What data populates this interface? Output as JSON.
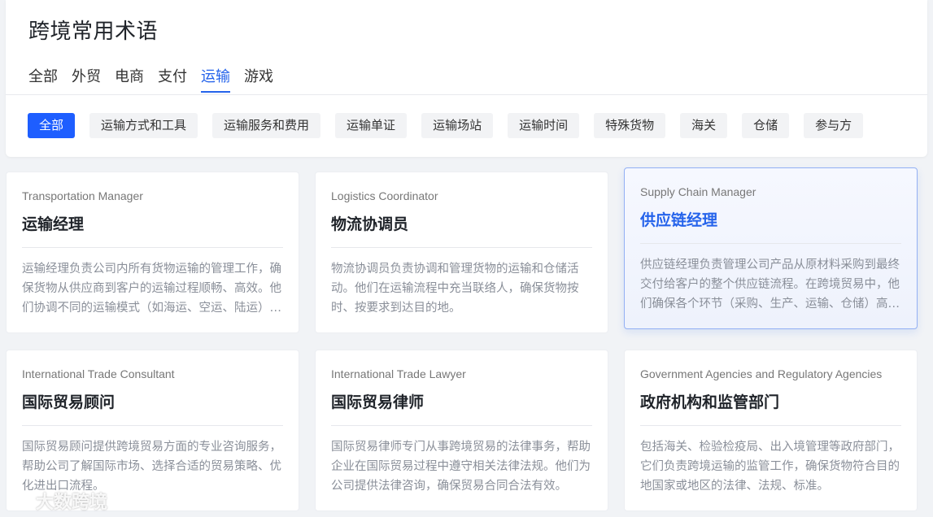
{
  "page": {
    "title": "跨境常用术语"
  },
  "tabs": [
    {
      "label": "全部"
    },
    {
      "label": "外贸"
    },
    {
      "label": "电商"
    },
    {
      "label": "支付"
    },
    {
      "label": "运输"
    },
    {
      "label": "游戏"
    }
  ],
  "active_tab": "运输",
  "filters": [
    {
      "label": "全部"
    },
    {
      "label": "运输方式和工具"
    },
    {
      "label": "运输服务和费用"
    },
    {
      "label": "运输单证"
    },
    {
      "label": "运输场站"
    },
    {
      "label": "运输时间"
    },
    {
      "label": "特殊货物"
    },
    {
      "label": "海关"
    },
    {
      "label": "仓储"
    },
    {
      "label": "参与方"
    }
  ],
  "cards": [
    {
      "en": "Transportation Manager",
      "zh": "运输经理",
      "desc": "运输经理负责公司内所有货物运输的管理工作，确保货物从供应商到客户的运输过程顺畅、高效。他们协调不同的运输模式（如海运、空运、陆运）以优化成本与时效。"
    },
    {
      "en": "Logistics Coordinator",
      "zh": "物流协调员",
      "desc": "物流协调员负责协调和管理货物的运输和仓储活动。他们在运输流程中充当联络人，确保货物按时、按要求到达目的地。"
    },
    {
      "en": "Supply Chain Manager",
      "zh": "供应链经理",
      "desc": "供应链经理负责管理公司产品从原材料采购到最终交付给客户的整个供应链流程。在跨境贸易中，他们确保各个环节（采购、生产、运输、仓储）高效衔接。"
    },
    {
      "en": "International Trade Consultant",
      "zh": "国际贸易顾问",
      "desc": "国际贸易顾问提供跨境贸易方面的专业咨询服务，帮助公司了解国际市场、选择合适的贸易策略、优化进出口流程。"
    },
    {
      "en": "International Trade Lawyer",
      "zh": "国际贸易律师",
      "desc": "国际贸易律师专门从事跨境贸易的法律事务，帮助企业在国际贸易过程中遵守相关法律法规。他们为公司提供法律咨询，确保贸易合同合法有效。"
    },
    {
      "en": "Government Agencies and Regulatory Agencies",
      "zh": "政府机构和监管部门",
      "desc": "包括海关、检验检疫局、出入境管理等政府部门，它们负责跨境运输的监管工作，确保货物符合目的地国家或地区的法律、法规、标准。"
    }
  ],
  "watermark": {
    "text": "大数跨境"
  },
  "colors": {
    "accent": "#2563eb",
    "chip_active": "#1e5eff"
  }
}
